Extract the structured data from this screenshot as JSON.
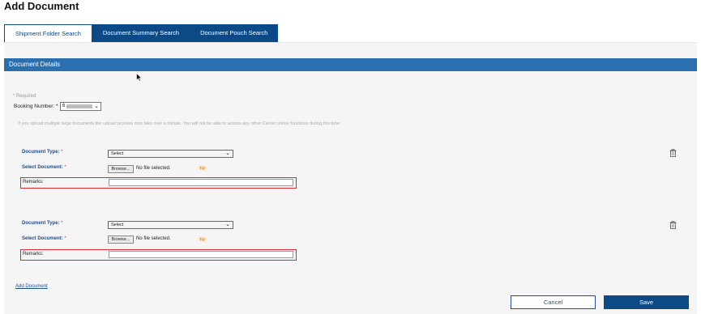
{
  "page": {
    "title": "Add Document"
  },
  "tabs": [
    {
      "label": "Shipment Folder Search",
      "active": true
    },
    {
      "label": "Document Summary Search",
      "active": false
    },
    {
      "label": "Document Pouch Search",
      "active": false
    }
  ],
  "section": {
    "title": "Document Details"
  },
  "form": {
    "required_note": "* Required",
    "booking_label": "Booking Number: *",
    "booking_value_prefix": "6",
    "notice": "If you upload multiple large documents the upload process may take over a minute. You will not be able to access any other Carrier online functions during this time."
  },
  "documents": [
    {
      "type_label": "Document Type:",
      "type_value": "Select",
      "select_label": "Select Document:",
      "browse_label": "Browse...",
      "file_status": "No file selected.",
      "tip_label": "Tip",
      "remarks_label": "Remarks:",
      "remarks_value": ""
    },
    {
      "type_label": "Document Type:",
      "type_value": "Select",
      "select_label": "Select Document:",
      "browse_label": "Browse...",
      "file_status": "No file selected.",
      "tip_label": "Tip",
      "remarks_label": "Remarks:",
      "remarks_value": ""
    }
  ],
  "required_marker": "*",
  "actions": {
    "add_document": "Add Document",
    "cancel": "Cancel",
    "save": "Save"
  },
  "colors": {
    "primary": "#0b4a86",
    "section_header": "#2a6fae",
    "label_blue": "#1f4f8f",
    "highlight_red": "#d92b2b"
  },
  "icons": {
    "delete": "trash-icon",
    "cursor": "mouse-pointer-icon",
    "dropdown": "chevron-down-icon"
  }
}
